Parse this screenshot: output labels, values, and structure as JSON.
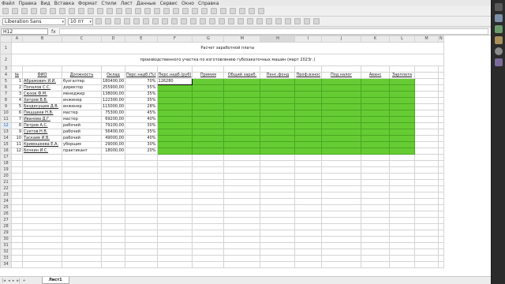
{
  "menu": [
    "Файл",
    "Правка",
    "Вид",
    "Вставка",
    "Формат",
    "Стили",
    "Лист",
    "Данные",
    "Сервис",
    "Окно",
    "Справка"
  ],
  "font_name": "Liberation Sans",
  "font_size": "10 пт",
  "name_box": "H12",
  "fx_label": "fx",
  "sheet_tab": "Лист1",
  "columns": [
    "A",
    "B",
    "C",
    "D",
    "E",
    "F",
    "G",
    "M",
    "H",
    "I",
    "J",
    "K",
    "L",
    "M",
    "N"
  ],
  "selected_column": "H",
  "selected_row": "12",
  "title": "Расчет заработной платы",
  "subtitle": "производственного участка по изготовлению губозакаточных машин (март 2023г.)",
  "headers": [
    "№",
    "ФИО",
    "Должность",
    "Оклад",
    "Перс.надб.(%)",
    "Перс.надб.(руб)",
    "Премия",
    "Общий зараб.",
    "Пенс.фонд",
    "Проф.взнос",
    "Под.налог",
    "Аванс",
    "Зарплата"
  ],
  "rows": [
    [
      "1",
      "Абрамович И.И.",
      "бухгалтер",
      "180400,00",
      "70%",
      "126280"
    ],
    [
      "2",
      "Попалов С.С.",
      "директор",
      "255900,00",
      "55%",
      ""
    ],
    [
      "3",
      "Сюзов Ф.М.",
      "менеджер",
      "138000,00",
      "35%",
      ""
    ],
    [
      "4",
      "Хитров В.В.",
      "инженер",
      "122300,00",
      "35%",
      ""
    ],
    [
      "5",
      "Бездесущев Д.В.",
      "инженер",
      "115000,00",
      "28%",
      ""
    ],
    [
      "6",
      "Пищщеев Н.В.",
      "мастер",
      "75300,00",
      "45%",
      ""
    ],
    [
      "7",
      "Иванова Д.Г.",
      "мастер",
      "69200,00",
      "40%",
      ""
    ],
    [
      "8",
      "Петров А.С.",
      "рабочий",
      "79100,00",
      "30%",
      ""
    ],
    [
      "9",
      "Суетов Н.В.",
      "рабочий",
      "56400,00",
      "35%",
      ""
    ],
    [
      "10",
      "Таскаев И.В.",
      "рабочий",
      "49000,00",
      "40%",
      ""
    ],
    [
      "11",
      "Кривошеева Е.А.",
      "уборщик",
      "29000,00",
      "30%",
      ""
    ],
    [
      "12",
      "Бочкин И.С.",
      "практикант",
      "18000,00",
      "20%",
      ""
    ]
  ]
}
